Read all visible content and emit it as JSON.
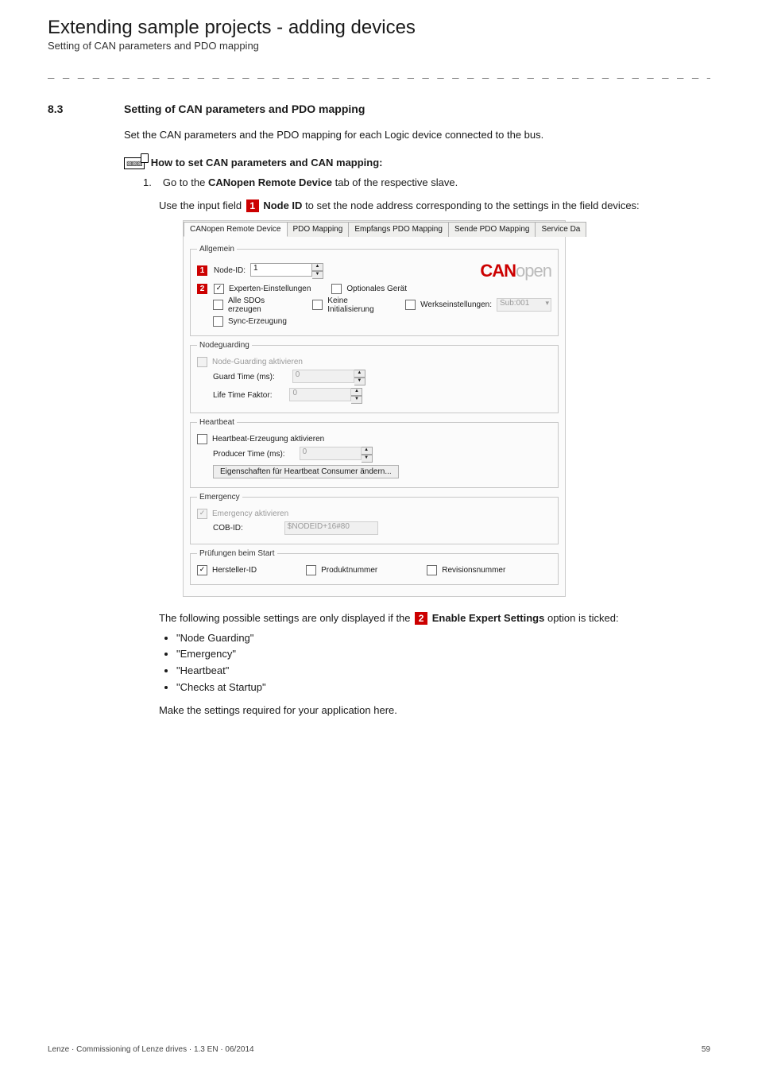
{
  "header": {
    "title": "Extending sample projects - adding devices",
    "subtitle": "Setting of CAN parameters and PDO mapping",
    "separator": "_ _ _ _ _ _ _ _ _ _ _ _ _ _ _ _ _ _ _ _ _ _ _ _ _ _ _ _ _ _ _ _ _ _ _ _ _ _ _ _ _ _ _ _ _ _ _ _ _ _ _ _ _ _ _ _ _ _ _ _ _ _ _ _"
  },
  "section": {
    "number": "8.3",
    "title": "Setting of CAN parameters and PDO mapping",
    "intro": "Set the CAN parameters and the PDO mapping for each Logic device connected to the bus."
  },
  "howto": {
    "label": "How to set CAN parameters and CAN mapping:",
    "step_num": "1.",
    "step_text_pre": "Go to the ",
    "step_text_bold": "CANopen Remote Device",
    "step_text_post": " tab of the respective slave.",
    "para2_pre": "Use the input field ",
    "para2_bold": " Node ID",
    "para2_post": " to set the node address corresponding to the settings in the field devices:"
  },
  "badges": {
    "one": "1",
    "two": "2"
  },
  "shot": {
    "tabs": {
      "t0": "CANopen Remote Device",
      "t1": "PDO Mapping",
      "t2": "Empfangs PDO Mapping",
      "t3": "Sende PDO Mapping",
      "t4": "Service Da"
    },
    "allgemein": {
      "legend": "Allgemein",
      "nodeid_label": "Node-ID:",
      "nodeid_value": "1",
      "canopen_a": "CAN",
      "canopen_b": "open",
      "experten": "Experten-Einstellungen",
      "optionales": "Optionales Gerät",
      "alle_sdo": "Alle SDOs erzeugen",
      "keine_init": "Keine Initialisierung",
      "werks": "Werkseinstellungen:",
      "werks_sel": "Sub:001",
      "sync": "Sync-Erzeugung"
    },
    "nodeguarding": {
      "legend": "Nodeguarding",
      "activate": "Node-Guarding aktivieren",
      "guard_time": "Guard Time (ms):",
      "guard_val": "0",
      "life_label": "Life Time Faktor:",
      "life_val": "0"
    },
    "heartbeat": {
      "legend": "Heartbeat",
      "activate": "Heartbeat-Erzeugung aktivieren",
      "producer": "Producer Time (ms):",
      "producer_val": "0",
      "props_btn": "Eigenschaften für Heartbeat Consumer ändern..."
    },
    "emergency": {
      "legend": "Emergency",
      "activate": "Emergency aktivieren",
      "cobid_label": "COB-ID:",
      "cobid_val": "$NODEID+16#80"
    },
    "startcheck": {
      "legend": "Prüfungen beim Start",
      "hersteller": "Hersteller-ID",
      "produkt": "Produktnummer",
      "revision": "Revisionsnummer"
    }
  },
  "after": {
    "para_pre": "The following possible settings are only displayed if the ",
    "para_bold": " Enable Expert Settings",
    "para_post": " option is ticked:",
    "b1": "\"Node Guarding\"",
    "b2": "\"Emergency\"",
    "b3": "\"Heartbeat\"",
    "b4": "\"Checks at Startup\"",
    "closing": "Make the settings required for your application here."
  },
  "footer": {
    "left": "Lenze · Commissioning of Lenze drives · 1.3 EN · 06/2014",
    "right": "59"
  }
}
